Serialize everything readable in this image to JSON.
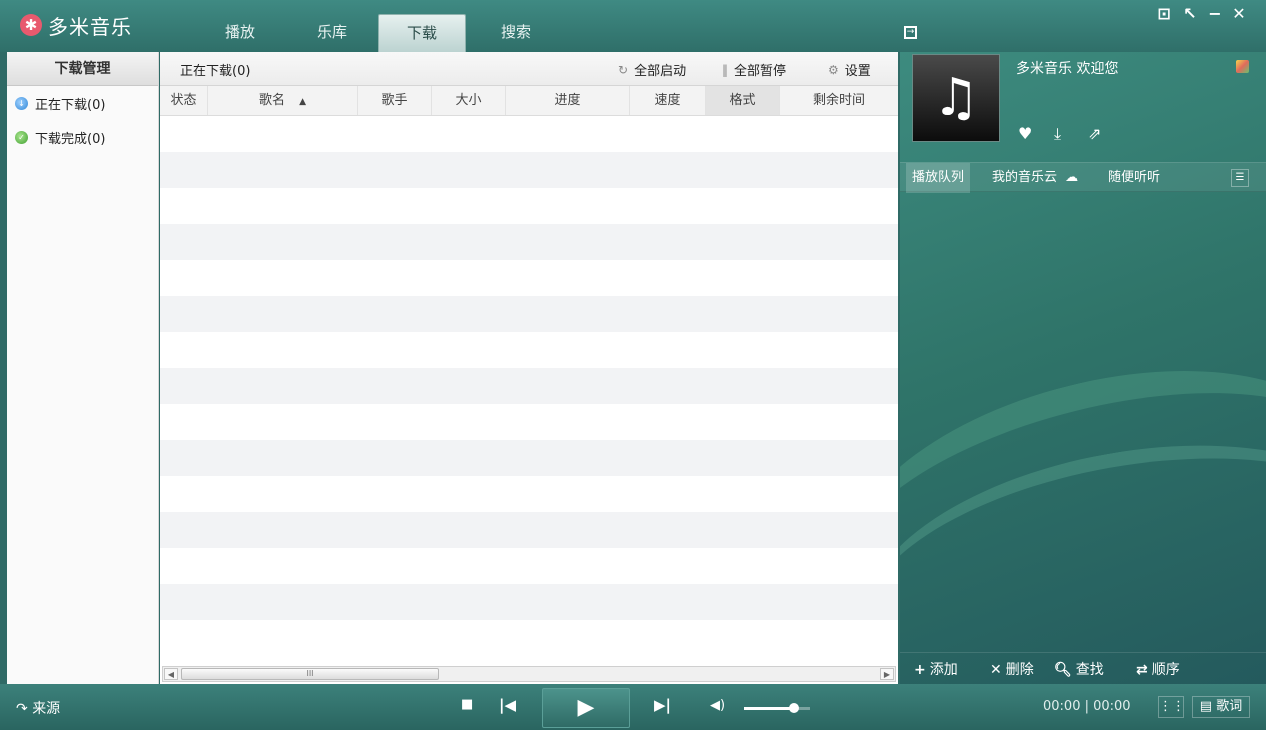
{
  "app": {
    "logo_mark": "✱",
    "name": "多米音乐"
  },
  "top_tabs": [
    {
      "label": "播放"
    },
    {
      "label": "乐库"
    },
    {
      "label": "下载",
      "active": true
    },
    {
      "label": "搜索"
    }
  ],
  "window_controls": {
    "icons": [
      "menu-icon",
      "mini-mode-icon",
      "minimize-icon",
      "close-icon"
    ],
    "menu": "⊡",
    "mini": "↖",
    "minimize": "−",
    "close": "✕"
  },
  "left_panel": {
    "title": "下载管理",
    "items": [
      {
        "label": "正在下载(0)",
        "icon": "downloading-icon"
      },
      {
        "label": "下载完成(0)",
        "icon": "completed-check-icon"
      }
    ]
  },
  "main": {
    "section_title": "正在下载(0)",
    "toolbar": {
      "start_all": "全部启动",
      "pause_all": "全部暂停",
      "settings": "设置"
    },
    "columns": [
      "状态",
      "歌名",
      "歌手",
      "大小",
      "进度",
      "速度",
      "格式",
      "剩余时间"
    ],
    "sort_indicator": "▲",
    "rows": [],
    "scrollbar": {
      "left": "◀",
      "right": "▶",
      "grip": "III"
    }
  },
  "right_panel": {
    "welcome": "多米音乐 欢迎您",
    "album_icon": "♫",
    "actions": [
      "heart-icon",
      "download-icon",
      "share-icon"
    ],
    "queue_tabs": [
      "播放队列",
      "我的音乐云",
      "随便听听"
    ],
    "footer": {
      "add": "添加",
      "delete": "删除",
      "find": "查找",
      "order": "顺序"
    }
  },
  "player": {
    "source": "来源",
    "time": "00:00 | 00:00",
    "lyrics": "歌词",
    "volume": 0.75,
    "colors": {
      "accent": "#2f6f69",
      "panel": "#fafafa"
    }
  }
}
